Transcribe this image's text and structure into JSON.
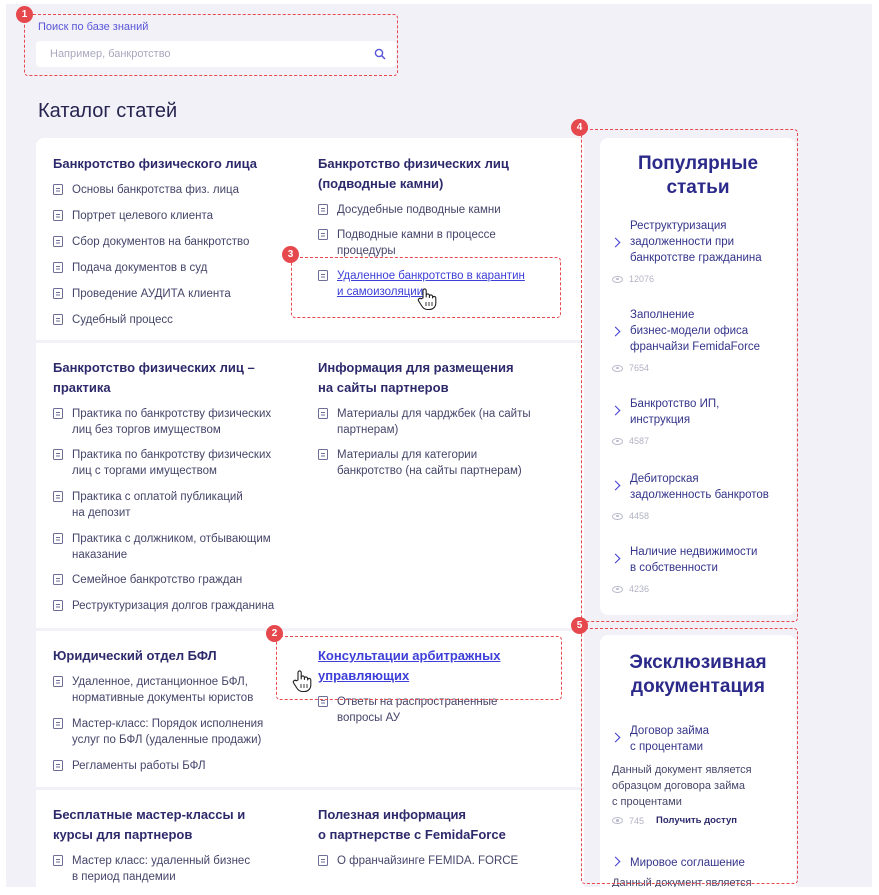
{
  "search": {
    "label": "Поиск по базе знаний",
    "placeholder": "Например, банкротство",
    "value": ""
  },
  "catalog_title": "Каталог статей",
  "sections": [
    {
      "heading": "Банкротство физического лица",
      "items": [
        "Основы банкротства физ. лица",
        "Портрет целевого клиента",
        "Сбор документов на банкротство",
        "Подача документов в суд",
        "Проведение АУДИТА клиента",
        "Судебный процесс"
      ]
    },
    {
      "heading_lines": [
        "Банкротство физических лиц",
        "(подводные камни)"
      ],
      "items": [
        [
          "Досудебные подводные камни"
        ],
        [
          "Подводные камни в процессе",
          "процедуры"
        ],
        [
          "Удаленное банкротство в карантин",
          "и самоизоляции"
        ]
      ]
    },
    {
      "heading_lines": [
        "Банкротство физических лиц –",
        "практика"
      ],
      "items": [
        [
          "Практика по банкротству физических",
          "лиц без торгов имуществом"
        ],
        [
          "Практика по банкротству физических",
          "лиц с торгами имуществом"
        ],
        [
          "Практика с оплатой публикаций",
          "на депозит"
        ],
        [
          "Практика с должником, отбывающим",
          "наказание"
        ],
        [
          "Семейное банкротство граждан"
        ],
        [
          "Реструктуризация долгов гражданина"
        ]
      ]
    },
    {
      "heading_lines": [
        "Информация для размещения",
        "на сайты партнеров"
      ],
      "items": [
        [
          "Материалы для чарджбек (на сайты",
          "партнерам)"
        ],
        [
          "Материалы для категории",
          "банкротство (на сайты партнерам)"
        ]
      ]
    },
    {
      "heading": "Юридический отдел БФЛ",
      "items": [
        [
          "Удаленное, дистанционное БФЛ,",
          "нормативные документы юристов"
        ],
        [
          "Мастер-класс: Порядок исполнения",
          "услуг по БФЛ (удаленные продажи)"
        ],
        [
          "Регламенты работы БФЛ"
        ]
      ]
    },
    {
      "heading_lines": [
        "Консультации арбитражных",
        "управляющих"
      ],
      "items": [
        [
          "Ответы на распространенные",
          "вопросы АУ"
        ]
      ]
    },
    {
      "heading_lines": [
        "Бесплатные мастер-классы и",
        "курсы для партнеров"
      ],
      "items": [
        [
          "Мастер класс: удаленный бизнес",
          "в период пандемии"
        ]
      ]
    },
    {
      "heading_lines": [
        "Полезная информация",
        "о партнерстве с FemidaForce"
      ],
      "items": [
        [
          "О франчайзинге FEMIDA. FORCE"
        ]
      ]
    }
  ],
  "popular": {
    "title_lines": [
      "Популярные",
      "статьи"
    ],
    "items": [
      {
        "lines": [
          "Реструктуризация",
          "задолженности при",
          "банкротстве гражданина"
        ],
        "views": "12076"
      },
      {
        "lines": [
          "Заполнение",
          "бизнес-модели офиса",
          "франчайзи FemidaForce"
        ],
        "views": "7654"
      },
      {
        "lines": [
          "Банкротство ИП,",
          "инструкция"
        ],
        "views": "4587"
      },
      {
        "lines": [
          "Дебиторская",
          "задолженность банкротов"
        ],
        "views": "4458"
      },
      {
        "lines": [
          "Наличие недвижимости",
          "в собственности"
        ],
        "views": "4236"
      }
    ]
  },
  "exclusive": {
    "title_lines": [
      "Эксклюзивная",
      "документация"
    ],
    "items": [
      {
        "lines": [
          "Договор займа",
          "с процентами"
        ],
        "desc_lines": [
          "Данный документ является",
          "образцом договора займа",
          "с процентами"
        ],
        "views": "745",
        "action": "Получить доступ"
      },
      {
        "lines": [
          "Мировое соглашение"
        ],
        "desc_lines": [
          "Данный документ является"
        ]
      }
    ]
  },
  "annotations": [
    "1",
    "2",
    "3",
    "4",
    "5"
  ],
  "colors": {
    "accent": "#3d3fd8",
    "annotation": "#e5484d",
    "background": "#f1f1f7"
  }
}
